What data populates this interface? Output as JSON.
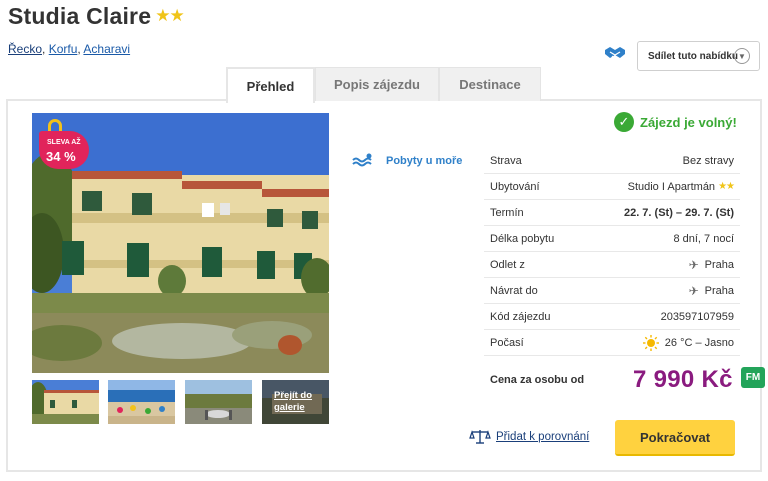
{
  "header": {
    "title": "Studia Claire",
    "stars": "★★",
    "breadcrumb": [
      {
        "label": "Řecko"
      },
      {
        "label": "Korfu"
      },
      {
        "label": "Acharavi"
      }
    ],
    "share_label": "Sdílet tuto nabídku",
    "share_icon": "handshake-icon"
  },
  "tabs": [
    {
      "label": "Přehled",
      "active": true
    },
    {
      "label": "Popis zájezdu",
      "active": false
    },
    {
      "label": "Destinace",
      "active": false
    }
  ],
  "gallery": {
    "sale_label": "SLEVA AŽ",
    "sale_value": "34 %",
    "gallery_link": "Přejít do galerie"
  },
  "trip_type": {
    "label": "Pobyty u moře",
    "icon": "sea-waves-icon"
  },
  "status": {
    "text": "Zájezd je volný!",
    "icon": "check-circle-icon",
    "color": "#3aa935"
  },
  "details": [
    {
      "label": "Strava",
      "value": "Bez stravy"
    },
    {
      "label": "Ubytování",
      "value": "Studio I Apartmán",
      "stars": "★★"
    },
    {
      "label": "Termín",
      "value": "22. 7. (St) – 29. 7. (St)",
      "bold": true
    },
    {
      "label": "Délka pobytu",
      "value": "8 dní, 7 nocí"
    },
    {
      "label": "Odlet z",
      "value": "Praha",
      "icon": "plane-icon"
    },
    {
      "label": "Návrat do",
      "value": "Praha",
      "icon": "plane-icon"
    },
    {
      "label": "Kód zájezdu",
      "value": "203597107959"
    },
    {
      "label": "Počasí",
      "value": "26 °C – Jasno",
      "icon": "sun-icon"
    }
  ],
  "price": {
    "label": "Cena za osobu od",
    "value": "7 990 Kč",
    "badge": "FM",
    "color": "#8a1b7f"
  },
  "actions": {
    "compare": "Přidat k porovnání",
    "continue": "Pokračovat"
  }
}
